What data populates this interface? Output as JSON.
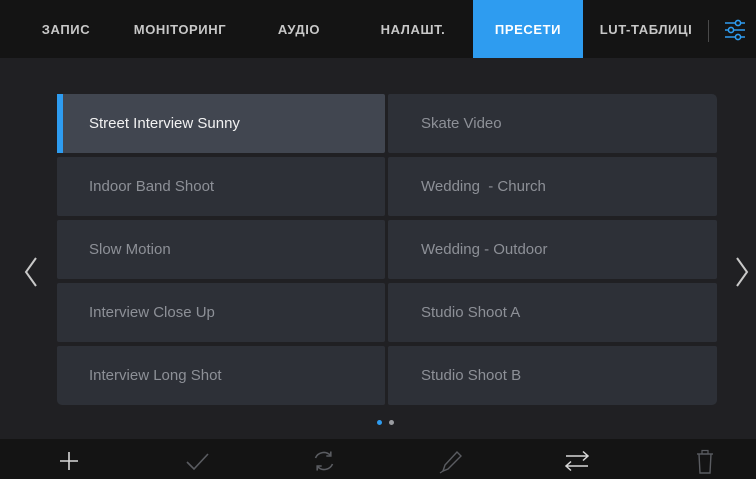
{
  "tabs": [
    {
      "label": "ЗАПИС",
      "active": false
    },
    {
      "label": "МОНІТОРИНГ",
      "active": false
    },
    {
      "label": "АУДІО",
      "active": false
    },
    {
      "label": "НАЛАШТ.",
      "active": false
    },
    {
      "label": "ПРЕСЕТИ",
      "active": true
    },
    {
      "label": "LUT-ТАБЛИЦІ",
      "active": false
    }
  ],
  "menu_icon": "sliders-icon",
  "presets": {
    "left": [
      {
        "label": "Street Interview Sunny",
        "selected": true
      },
      {
        "label": "Indoor Band Shoot",
        "selected": false
      },
      {
        "label": "Slow Motion",
        "selected": false
      },
      {
        "label": "Interview Close Up",
        "selected": false
      },
      {
        "label": "Interview Long Shot",
        "selected": false
      }
    ],
    "right": [
      {
        "label": "Skate Video",
        "selected": false
      },
      {
        "label": "Wedding  - Church",
        "selected": false
      },
      {
        "label": "Wedding - Outdoor",
        "selected": false
      },
      {
        "label": "Studio Shoot A",
        "selected": false
      },
      {
        "label": "Studio Shoot B",
        "selected": false
      }
    ]
  },
  "pagination": {
    "pages": 2,
    "current": 1
  },
  "toolbar": [
    "add-icon",
    "apply-check-icon",
    "update-icon",
    "rename-pencil-icon",
    "import-export-icon",
    "delete-trash-icon"
  ],
  "colors": {
    "accent": "#2e9cf0",
    "bar_background": "#141414",
    "page_background": "#202023",
    "cell": "#2d3037",
    "cell_selected": "#414650",
    "text_dim": "#8d9097",
    "icon_dim": "#5a5c61"
  }
}
